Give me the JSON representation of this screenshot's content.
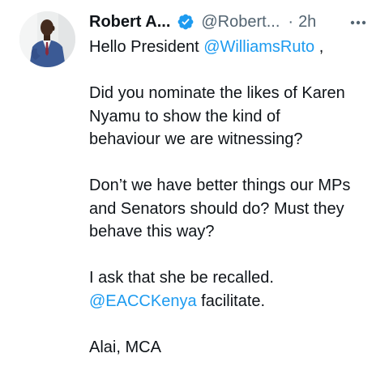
{
  "author": {
    "name": "Robert A...",
    "handle": "@Robert...",
    "separator": "·",
    "time": "2h",
    "verified_icon": "verified-badge-icon",
    "avatar_alt": "avatar"
  },
  "menu": {
    "more_icon": "more-horizontal-icon"
  },
  "tweet": {
    "line1_prefix": "Hello President ",
    "mention1": "@WilliamsRuto",
    "line1_suffix": " ,",
    "para2_line1": "Did you nominate the likes of Karen",
    "para2_line2": "Nyamu to show the kind of",
    "para2_line3": "behaviour we are witnessing?",
    "para3_line1": "Don’t we have better things our MPs",
    "para3_line2": "and Senators should do? Must they",
    "para3_line3": "behave this way?",
    "para4_line1": "I ask that she be recalled.",
    "mention2": "@EACCKenya",
    "para4_line2_suffix": " facilitate.",
    "signature": "Alai, MCA"
  },
  "colors": {
    "link": "#1d9bf0",
    "text": "#0f1419",
    "muted": "#536471"
  }
}
